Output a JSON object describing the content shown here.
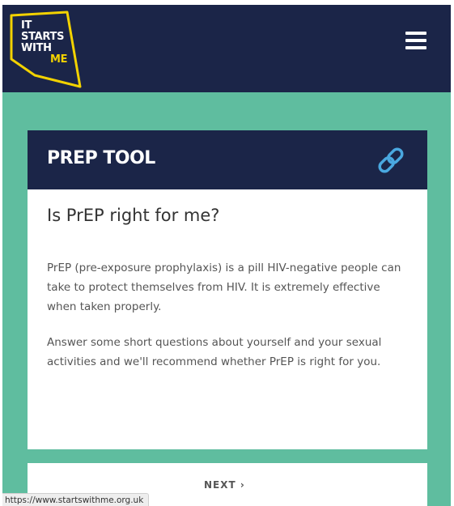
{
  "header": {
    "logo": {
      "lines": [
        "IT",
        "STARTS",
        "WITH",
        "ME"
      ],
      "accent_color": "#f2d200"
    },
    "menu_icon": "hamburger-menu-icon",
    "background_color": "#1b2548"
  },
  "page": {
    "background_color": "#5fbd9f"
  },
  "card": {
    "title": "PREP TOOL",
    "title_icon": "link-icon",
    "heading": "Is PrEP right for me?",
    "paragraphs": [
      "PrEP (pre-exposure prophylaxis) is a pill HIV-negative people can take to protect themselves from HIV. It is extremely effective when taken properly.",
      "Answer some short questions about yourself and your sexual activities and we'll recommend whether PrEP is right for you."
    ]
  },
  "navigation": {
    "next_label": "NEXT ›"
  },
  "status_bar": {
    "url": "https://www.startswithme.org.uk"
  }
}
